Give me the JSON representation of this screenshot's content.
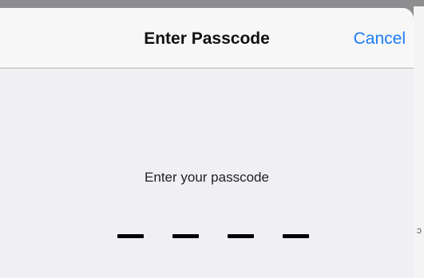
{
  "navbar": {
    "title": "Enter Passcode",
    "cancel_label": "Cancel"
  },
  "passcode": {
    "prompt": "Enter your passcode",
    "digits_total": 4,
    "digits_entered": 0
  },
  "background_text": {
    "edge_glyph": "ɔ"
  },
  "colors": {
    "accent": "#1a7cf5",
    "sheet_background": "#efeff4",
    "navbar_background": "#f7f7f7",
    "dim_overlay": "#8e8e90"
  }
}
